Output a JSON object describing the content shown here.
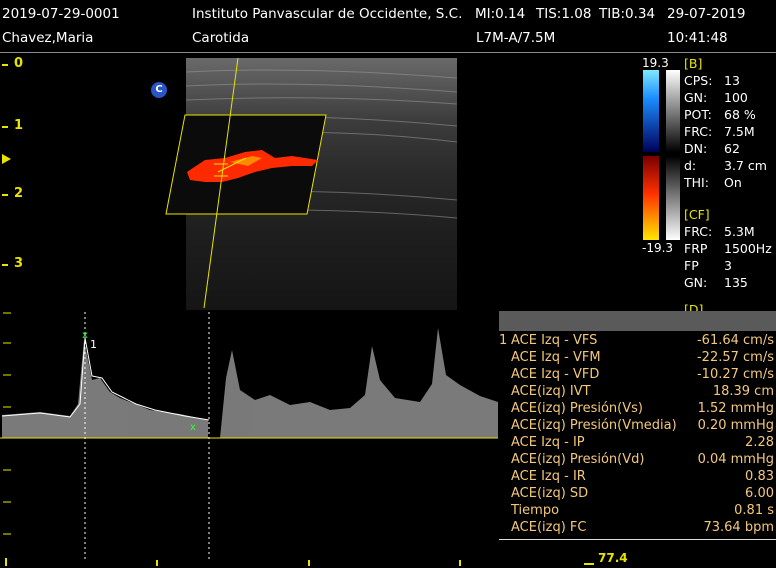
{
  "header": {
    "exam_id": "2019-07-29-0001",
    "institution": "Instituto Panvascular de Occidente, S.C.",
    "mi": "MI:0.14",
    "tis": "TIS:1.08",
    "tib": "TIB:0.34",
    "date": "29-07-2019",
    "patient": "Chavez,Maria",
    "study": "Carotida",
    "probe": "L7M-A/7.5M",
    "time": "10:41:48"
  },
  "depth_scale": [
    "0",
    "1",
    "2",
    "3"
  ],
  "image": {
    "mode_badge": "C",
    "scale_max": "19.3",
    "scale_min": "-19.3"
  },
  "params": {
    "b_header": "[B]",
    "b_rows": [
      {
        "k": "CPS:",
        "v": "13"
      },
      {
        "k": "GN:",
        "v": "100"
      },
      {
        "k": "POT:",
        "v": "68 %"
      },
      {
        "k": "FRC:",
        "v": "7.5M"
      },
      {
        "k": "DN:",
        "v": "62"
      },
      {
        "k": "d:",
        "v": "3.7 cm"
      },
      {
        "k": "THI:",
        "v": "On"
      }
    ],
    "cf_header": "[CF]",
    "cf_rows": [
      {
        "k": "FRC:",
        "v": "5.3M"
      },
      {
        "k": "FRP",
        "v": "1500Hz"
      },
      {
        "k": "FP",
        "v": "3"
      },
      {
        "k": "GN:",
        "v": "135"
      }
    ],
    "d_header": "[D]"
  },
  "doppler": {
    "cursor_marker": "1"
  },
  "measurements": {
    "rows": [
      {
        "idx": "1",
        "label": "ACE Izq - VFS",
        "value": "-61.64 cm/s"
      },
      {
        "idx": "",
        "label": "ACE Izq - VFM",
        "value": "-22.57 cm/s"
      },
      {
        "idx": "",
        "label": "ACE Izq - VFD",
        "value": "-10.27 cm/s"
      },
      {
        "idx": "",
        "label": "ACE(izq) IVT",
        "value": "18.39 cm"
      },
      {
        "idx": "",
        "label": "ACE(izq) Presión(Vs)",
        "value": "1.52 mmHg"
      },
      {
        "idx": "",
        "label": "ACE(izq) Presión(Vmedia)",
        "value": "0.20 mmHg"
      },
      {
        "idx": "",
        "label": "ACE Izq - IP",
        "value": "2.28"
      },
      {
        "idx": "",
        "label": "ACE(izq) Presión(Vd)",
        "value": "0.04 mmHg"
      },
      {
        "idx": "",
        "label": "ACE Izq - IR",
        "value": "0.83"
      },
      {
        "idx": "",
        "label": "ACE(izq) SD",
        "value": "6.00"
      },
      {
        "idx": "",
        "label": "Tiempo",
        "value": "0.81 s"
      },
      {
        "idx": "",
        "label": "ACE(izq) FC",
        "value": "73.64 bpm"
      }
    ]
  },
  "footer": {
    "frame_counter": "77.4"
  },
  "colors": {
    "accent_yellow": "#e8e400",
    "measure_text": "#f4c87a",
    "flow_red": "#ff2a00"
  }
}
